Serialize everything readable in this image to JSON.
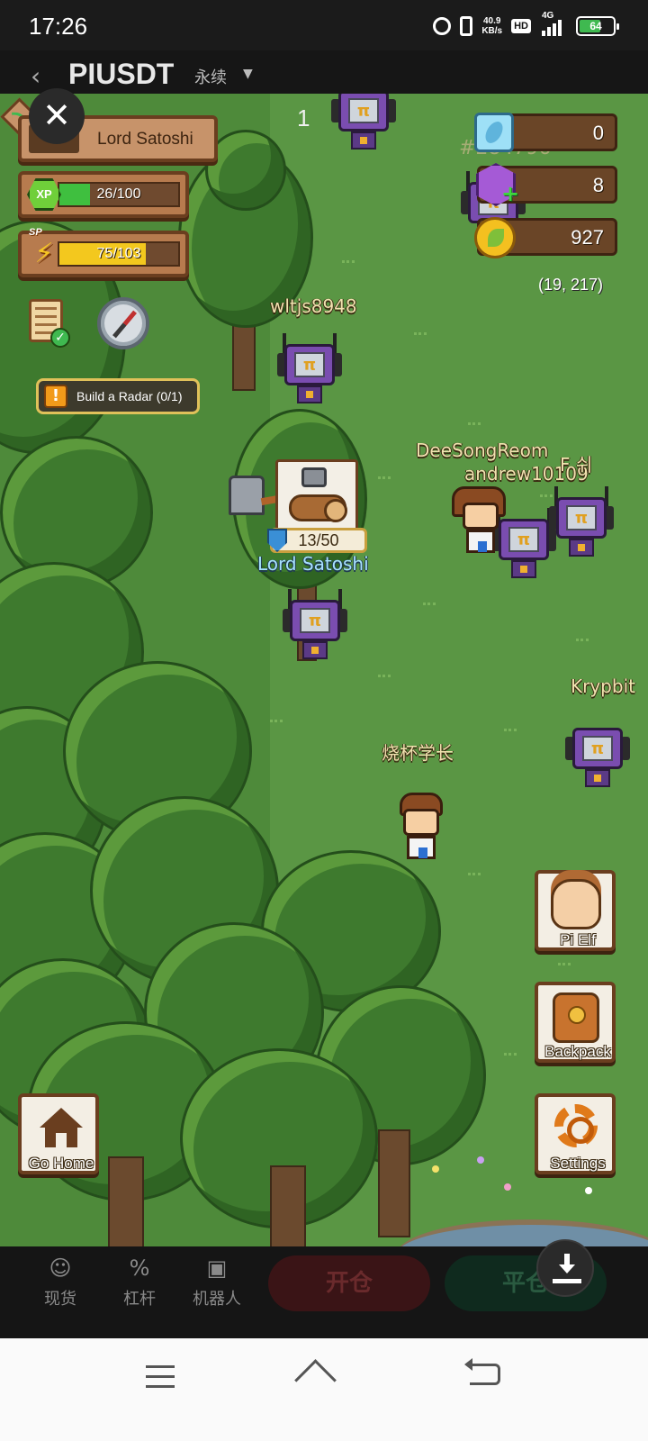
{
  "status_bar": {
    "time": "17:26",
    "net_speed": "40.9",
    "net_speed_unit": "KB/s",
    "hd_label": "HD",
    "network_type": "4G",
    "battery": "64",
    "battery_fraction": 0.64
  },
  "background_app": {
    "title": "PIUSDT",
    "subtitle": "永续",
    "bottom_tabs": [
      {
        "label": "现货",
        "icon": "smiley-icon"
      },
      {
        "label": "杠杆",
        "icon": "percent-icon"
      },
      {
        "label": "机器人",
        "icon": "robot-icon"
      }
    ],
    "open_button": "开仓",
    "close_button": "平仓"
  },
  "game": {
    "page_indicator": "1",
    "player": {
      "name": "Lord Satoshi",
      "xp_text": "26/100",
      "xp_fraction": 0.26,
      "sp_text": "75/103",
      "sp_fraction": 0.728
    },
    "badges": {
      "xp": "XP",
      "sp": "SP"
    },
    "task": {
      "text": "Build a Radar (0/1)"
    },
    "resources": {
      "crystal": "0",
      "gem": "8",
      "coin": "927"
    },
    "coordinates": "(19, 217)",
    "ghost_id": "#284796",
    "work_progress": "13/50",
    "other_players": [
      "wltjs8948",
      "DeeSongReom",
      "andrew10109",
      "F 쉬",
      "Krypbit",
      "烧杯学长"
    ],
    "self_label": "Lord Satoshi",
    "side_menu": {
      "pi_elf": "Pi Elf",
      "backpack": "Backpack",
      "settings": "Settings"
    },
    "go_home": "Go Home",
    "colors": {
      "xp_fill": "#3fbf3f",
      "sp_fill": "#f3c81e",
      "grass": "#4e8a3a"
    }
  }
}
